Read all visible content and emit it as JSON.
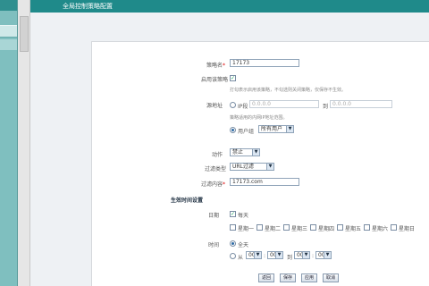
{
  "header": {
    "title": "全局控制策略配置"
  },
  "form": {
    "policy_name": {
      "label": "策略名",
      "value": "17173"
    },
    "enable": {
      "label": "启用该策略",
      "hint": "打勾表示启用该策略，不勾选则关闭策略，仅保存不生效。"
    },
    "scope": {
      "label": "源地址",
      "ip_label": "IP段",
      "ip_from": "0.0.0.0",
      "to_label": "到",
      "ip_to": "0.0.0.0",
      "hint": "策略适用的内网IP地址范围。",
      "user_group_label": "用户组",
      "user_group_value": "所有用户"
    },
    "action": {
      "label": "动作",
      "value": "禁止"
    },
    "filter_type": {
      "label": "过滤类型",
      "value": "URL过滤"
    },
    "filter_content": {
      "label": "过滤内容",
      "value": "17173.com"
    },
    "schedule_section": "生效时间设置",
    "date": {
      "label": "日期",
      "everyday_label": "每天",
      "weekdays": [
        "星期一",
        "星期二",
        "星期三",
        "星期四",
        "星期五",
        "星期六",
        "星期日"
      ]
    },
    "time": {
      "label": "时间",
      "all_day_label": "全天",
      "from_label": "从",
      "from_h": "00",
      "from_m": "00",
      "to_label": "到",
      "to_h": "00",
      "to_m": "00"
    }
  },
  "buttons": {
    "back": "返回",
    "save": "保存",
    "apply": "应用",
    "cancel": "取消"
  }
}
